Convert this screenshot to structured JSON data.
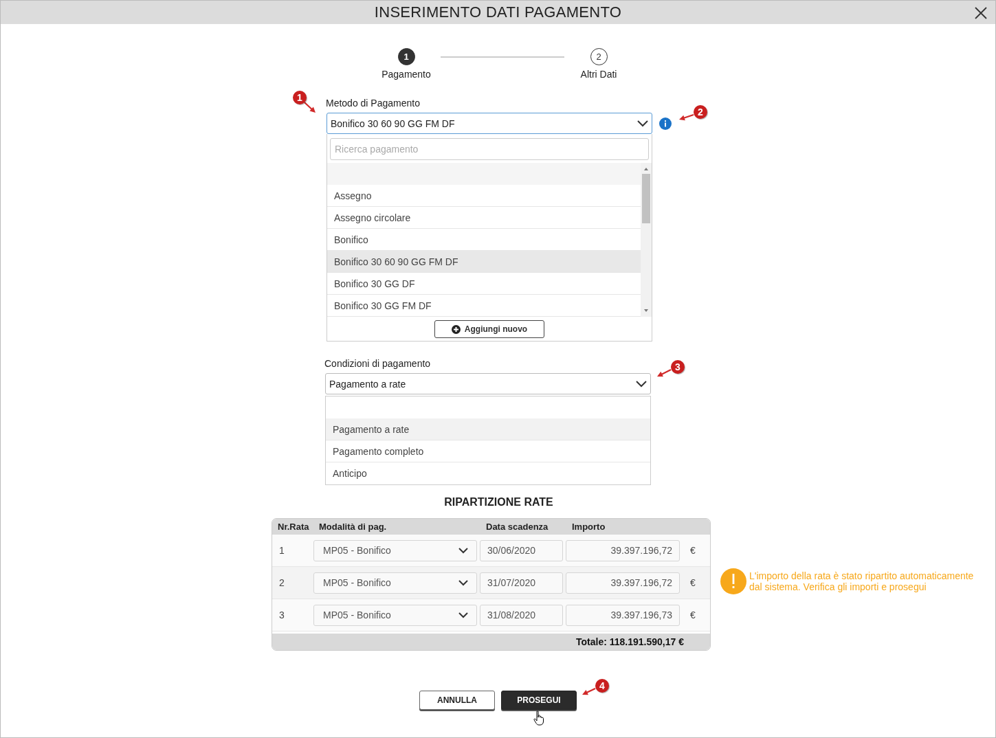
{
  "window": {
    "title": "INSERIMENTO DATI PAGAMENTO"
  },
  "stepper": [
    {
      "number": "1",
      "label": "Pagamento",
      "selected": true
    },
    {
      "number": "2",
      "label": "Altri Dati",
      "selected": false
    }
  ],
  "payment_method": {
    "label": "Metodo di Pagamento",
    "value": "Bonifico 30 60 90 GG FM DF",
    "search_placeholder": "Ricerca pagamento",
    "add_button": "Aggiungi nuovo",
    "options": [
      {
        "label": "Assegno",
        "selected": false
      },
      {
        "label": "Assegno circolare",
        "selected": false
      },
      {
        "label": "Bonifico",
        "selected": false
      },
      {
        "label": "Bonifico 30 60 90 GG FM DF",
        "selected": true
      },
      {
        "label": "Bonifico 30 GG DF",
        "selected": false
      },
      {
        "label": "Bonifico 30 GG FM DF",
        "selected": false
      }
    ]
  },
  "payment_terms": {
    "label": "Condizioni di pagamento",
    "value": "Pagamento a rate",
    "options": [
      {
        "label": "Pagamento a rate",
        "selected": true
      },
      {
        "label": "Pagamento completo",
        "selected": false
      },
      {
        "label": "Anticipo",
        "selected": false
      }
    ]
  },
  "installments": {
    "title": "RIPARTIZIONE RATE",
    "columns": [
      "Nr.Rata",
      "Modalità di pag.",
      "Data scadenza",
      "Importo"
    ],
    "rows": [
      {
        "number": "1",
        "method": "MP05 - Bonifico",
        "due_date": "30/06/2020",
        "amount": "39.397.196,72",
        "currency": "€"
      },
      {
        "number": "2",
        "method": "MP05 - Bonifico",
        "due_date": "31/07/2020",
        "amount": "39.397.196,72",
        "currency": "€"
      },
      {
        "number": "3",
        "method": "MP05 - Bonifico",
        "due_date": "31/08/2020",
        "amount": "39.397.196,73",
        "currency": "€"
      }
    ],
    "total": "Totale: 118.191.590,17 €"
  },
  "notice": {
    "text": "L'importo della rata è stato ripartito automaticamente dal sistema. Verifica gli importi e prosegui"
  },
  "buttons": [
    {
      "label": "ANNULLA",
      "kind": "secondary"
    },
    {
      "label": "PROSEGUI",
      "kind": "primary"
    }
  ],
  "annotations": [
    {
      "number": "1"
    },
    {
      "number": "2"
    },
    {
      "number": "3"
    },
    {
      "number": "4"
    }
  ]
}
